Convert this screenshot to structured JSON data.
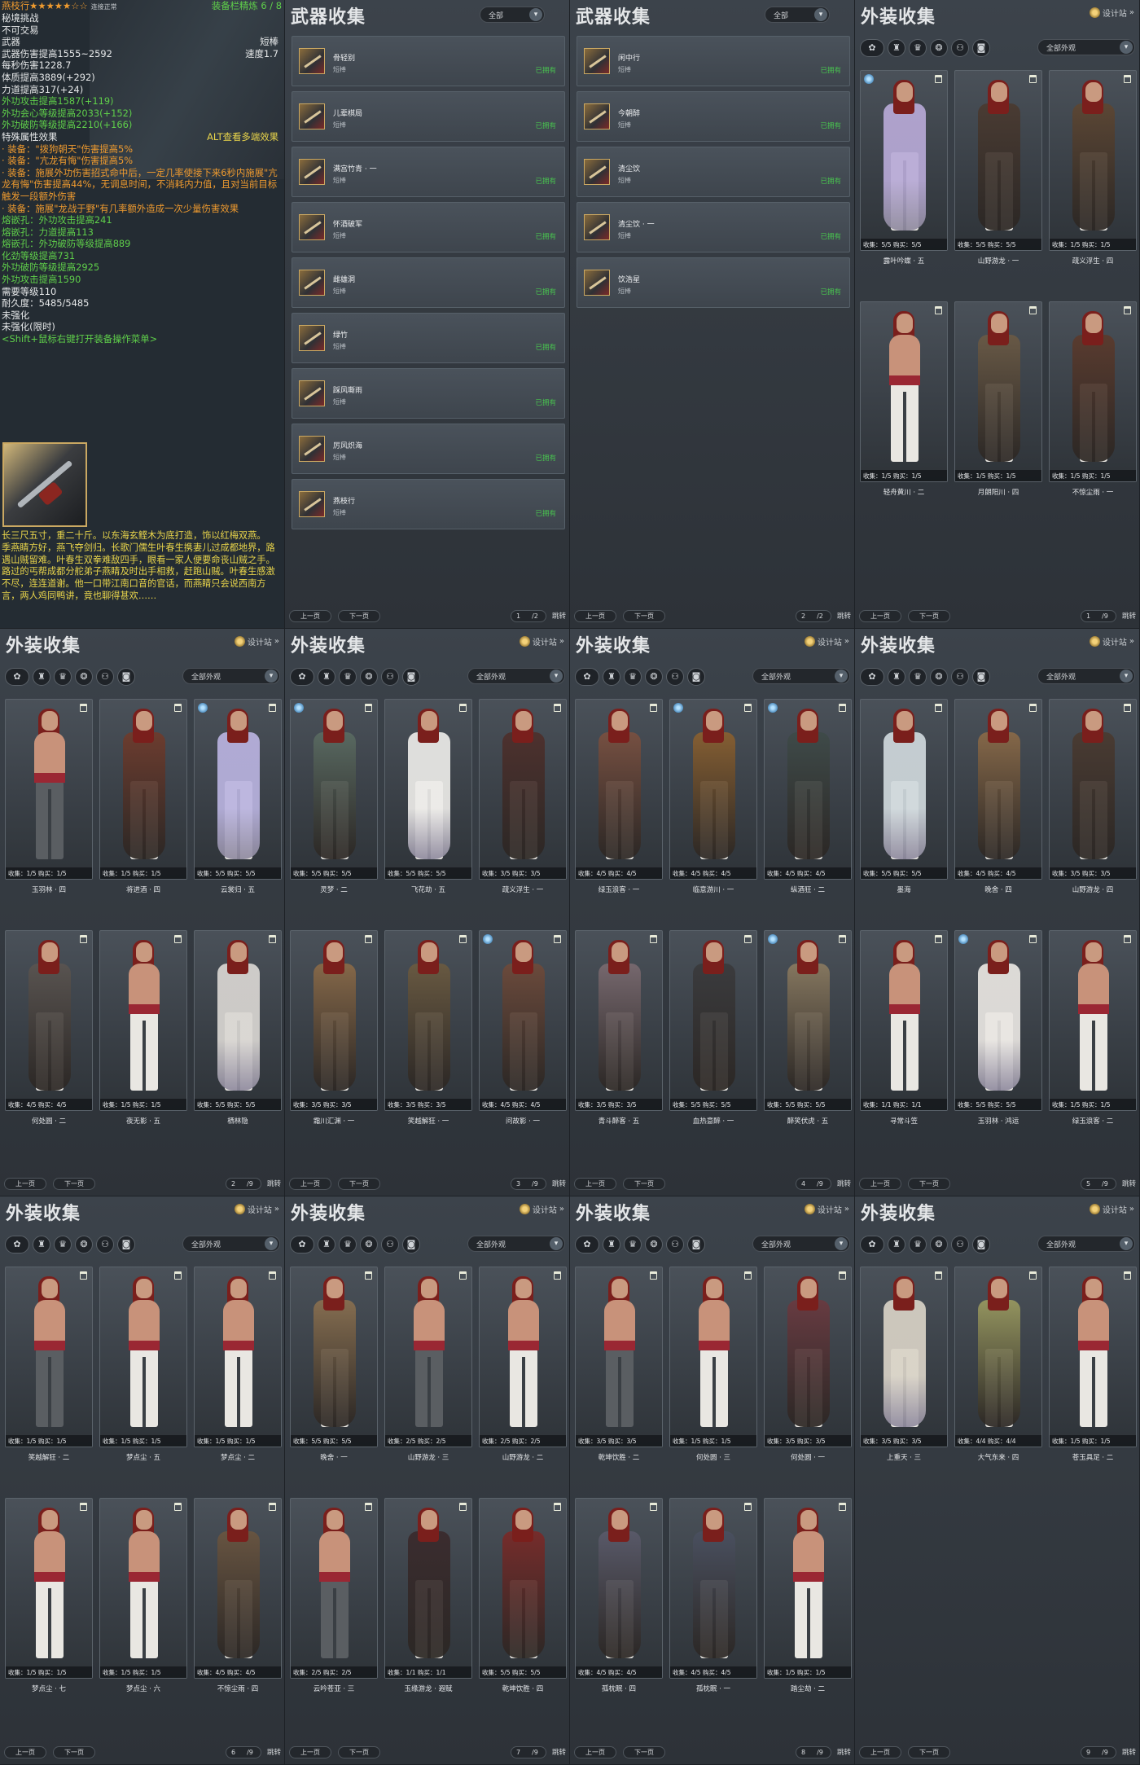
{
  "colors": {
    "accent_gold": "#caa862",
    "green": "#48c44f",
    "orange": "#ee9a2f",
    "yellow": "#e9d54b",
    "bg": "#2e3339"
  },
  "tooltip": {
    "header_name": "燕枝行★★★★★☆☆",
    "header_state": "连接正常",
    "refine": "装备栏精炼 6 / 8",
    "lines": [
      {
        "t": "秘境挑战",
        "c": "c-white"
      },
      {
        "t": "不可交易",
        "c": "c-white"
      },
      {
        "t": "武器",
        "c": "c-white",
        "r": "短棒"
      },
      {
        "t": "武器伤害提高1555~2592",
        "c": "c-white",
        "r": "速度1.7"
      },
      {
        "t": "每秒伤害1228.7",
        "c": "c-white"
      },
      {
        "t": "体质提高3889(+292)",
        "c": "c-white"
      },
      {
        "t": "力道提高317(+24)",
        "c": "c-white"
      },
      {
        "t": "外功攻击提高1587(+119)",
        "c": "c-green"
      },
      {
        "t": "外功会心等级提高2033(+152)",
        "c": "c-green"
      },
      {
        "t": "外功破防等级提高2210(+166)",
        "c": "c-green"
      },
      {
        "t": "特殊属性效果",
        "c": "c-white",
        "r": "ALT查看多端效果",
        "rc": "c-yellow"
      },
      {
        "t": "· 装备：\"拨狗朝天\"伤害提高5%",
        "c": "c-orange"
      },
      {
        "t": "· 装备：\"亢龙有悔\"伤害提高5%",
        "c": "c-orange"
      },
      {
        "t": "· 装备：施展外功伤害招式命中后，一定几率使接下来6秒内施展\"亢龙有悔\"伤害提高44%，无调息时间，不消耗内力值，且对当前目标触发一段额外伤害",
        "c": "c-orange",
        "w": true
      },
      {
        "t": "· 装备：施展\"龙战于野\"有几率额外造成一次少量伤害效果",
        "c": "c-orange",
        "w": true
      },
      {
        "t": "熔嵌孔：外功攻击提高241",
        "c": "c-green"
      },
      {
        "t": "熔嵌孔：力道提高113",
        "c": "c-green"
      },
      {
        "t": "熔嵌孔：外功破防等级提高889",
        "c": "c-green"
      },
      {
        "t": "化劲等级提高731",
        "c": "c-green"
      },
      {
        "t": "外功破防等级提高2925",
        "c": "c-green"
      },
      {
        "t": "外功攻击提高1590",
        "c": "c-green"
      },
      {
        "t": "需要等级110",
        "c": "c-white"
      },
      {
        "t": "耐久度：5485/5485",
        "c": "c-white"
      },
      {
        "t": "未强化",
        "c": "c-white"
      },
      {
        "t": "未强化(限时)",
        "c": "c-white"
      },
      {
        "t": "<Shift+鼠标右键打开装备操作菜单>",
        "c": "c-green"
      }
    ],
    "lore1": "长三尺五寸，重二十斤。以东海玄鲣木为底打造，饰以红梅双燕。",
    "lore2": "季燕睛方好，燕飞夺剑归。长歌门儒生叶春生携妻儿过成都地界，路遇山贼留难。叶春生双拳难敌四手，眼看一家人便要命丧山贼之手。路过的丐帮成都分舵弟子燕睛及时出手相救，赶跑山贼。叶春生感激不尽，连连道谢。他一口带江南口音的官话，而燕睛只会说西南方言，两人鸡同鸭讲，竟也聊得甚欢……"
  },
  "weapons": [
    {
      "title": "武器收集",
      "filter": "全部",
      "items": [
        {
          "name": "骨轻别",
          "type": "短棒",
          "status": "已拥有"
        },
        {
          "name": "儿辈棋局",
          "type": "短棒",
          "status": "已拥有"
        },
        {
          "name": "满宫竹青 · 一",
          "type": "短棒",
          "status": "已拥有"
        },
        {
          "name": "怀酒破军",
          "type": "短棒",
          "status": "已拥有"
        },
        {
          "name": "雌雄洞",
          "type": "短棒",
          "status": "已拥有"
        },
        {
          "name": "绿竹",
          "type": "短棒",
          "status": "已拥有"
        },
        {
          "name": "踩风嘶雨",
          "type": "短棒",
          "status": "已拥有"
        },
        {
          "name": "厉风炽海",
          "type": "短棒",
          "status": "已拥有"
        },
        {
          "name": "燕枝行",
          "type": "短棒",
          "status": "已拥有"
        }
      ],
      "prev": "上一页",
      "next": "下一页",
      "page": "1",
      "total": "/2",
      "jump": "跳转"
    },
    {
      "title": "武器收集",
      "filter": "全部",
      "items": [
        {
          "name": "闲中行",
          "type": "短棒",
          "status": "已拥有"
        },
        {
          "name": "今朝醉",
          "type": "短棒",
          "status": "已拥有"
        },
        {
          "name": "清尘饮",
          "type": "短棒",
          "status": "已拥有"
        },
        {
          "name": "清尘饮 · 一",
          "type": "短棒",
          "status": "已拥有"
        },
        {
          "name": "饮浩星",
          "type": "短棒",
          "status": "已拥有"
        }
      ],
      "prev": "上一页",
      "next": "下一页",
      "page": "2",
      "total": "/2",
      "jump": "跳转"
    }
  ],
  "outfit_common": {
    "title": "外装收集",
    "design": "设计站",
    "more": "»",
    "filter": "全部外观",
    "prev": "上一页",
    "next": "下一页",
    "jump": "跳转",
    "icons": [
      "outfit-all-icon",
      "clothes-icon",
      "hat-icon",
      "cloak-icon",
      "pendant-icon",
      "bag-icon"
    ],
    "icon_glyphs": [
      "✿",
      "♜",
      "♛",
      "❂",
      "⚇",
      "◙"
    ]
  },
  "outfits": [
    {
      "page": "1",
      "total": "/9",
      "cards": [
        {
          "name": "露叶吟蝶 · 五",
          "stats": "收集：5/5  购买：5/5",
          "s": "robe",
          "col": "#b7a9d6",
          "badge": true
        },
        {
          "name": "山野游龙 · 一",
          "stats": "收集：5/5  购买：5/5",
          "s": "dark",
          "col": "#4a3a30"
        },
        {
          "name": "疏义浮生 · 四",
          "stats": "收集：1/5  购买：1/5",
          "s": "dark",
          "col": "#5d4632"
        },
        {
          "name": "轻舟黄川 · 二",
          "stats": "收集：1/5  购买：1/5",
          "s": "base"
        },
        {
          "name": "月朗阳川 · 四",
          "stats": "收集：1/5  购买：1/5",
          "s": "dark",
          "col": "#6b5a45"
        },
        {
          "name": "不惊尘雨 · 一",
          "stats": "收集：1/5  购买：1/5",
          "s": "dark",
          "col": "#5b3a2c"
        }
      ]
    },
    {
      "page": "2",
      "total": "/9",
      "cards": [
        {
          "name": "玉羽林 · 四",
          "stats": "收集：1/5  购买：1/5",
          "s": "base2"
        },
        {
          "name": "将进酒 · 四",
          "stats": "收集：1/5  购买：1/5",
          "s": "dark",
          "col": "#6f3b2c"
        },
        {
          "name": "云裳归 · 五",
          "stats": "收集：5/5  购买：5/5",
          "s": "robe",
          "col": "#b9b3df",
          "badge": true
        },
        {
          "name": "何处圆 · 二",
          "stats": "收集：4/5  购买：4/5",
          "s": "dark",
          "col": "#5a5450"
        },
        {
          "name": "夜无影 · 五",
          "stats": "收集：1/5  购买：1/5",
          "s": "base"
        },
        {
          "name": "栖林隐",
          "stats": "收集：5/5  购买：5/5",
          "s": "robe",
          "col": "#d9d6d2"
        }
      ]
    },
    {
      "page": "3",
      "total": "/9",
      "cards": [
        {
          "name": "灵梦 · 二",
          "stats": "收集：5/5  购买：5/5",
          "s": "dark",
          "col": "#5a6b62",
          "badge": true
        },
        {
          "name": "飞花劫 · 五",
          "stats": "收集：5/5  购买：5/5",
          "s": "robe",
          "col": "#ecebe8"
        },
        {
          "name": "疏义浮生 · 一",
          "stats": "收集：3/5  购买：3/5",
          "s": "dark",
          "col": "#4e2f2b"
        },
        {
          "name": "霜川汇渊 · 一",
          "stats": "收集：3/5  购买：3/5",
          "s": "dark",
          "col": "#8a6a48"
        },
        {
          "name": "笑越解狂 · 一",
          "stats": "收集：3/5  购买：3/5",
          "s": "dark",
          "col": "#6b5a40"
        },
        {
          "name": "问故影 · 一",
          "stats": "收集：4/5  购买：4/5",
          "s": "dark",
          "col": "#6e4a3a",
          "badge": true
        }
      ]
    },
    {
      "page": "4",
      "total": "/9",
      "cards": [
        {
          "name": "绿玉浪客 · 一",
          "stats": "收集：4/5  购买：4/5",
          "s": "dark",
          "col": "#7a5040"
        },
        {
          "name": "临意游川 · 一",
          "stats": "收集：4/5  购买：4/5",
          "s": "dark",
          "col": "#8a6030",
          "badge": true
        },
        {
          "name": "纵酒狂 · 二",
          "stats": "收集：4/5  购买：4/5",
          "s": "dark",
          "col": "#3e4a48",
          "badge": true
        },
        {
          "name": "青斗醉客 · 五",
          "stats": "收集：3/5  购买：3/5",
          "s": "dark",
          "col": "#7a6a70"
        },
        {
          "name": "血热意醉 · 一",
          "stats": "收集：5/5  购买：5/5",
          "s": "dark",
          "col": "#3a3a3c"
        },
        {
          "name": "醉笑伏虎 · 五",
          "stats": "收集：5/5  购买：5/5",
          "s": "dark",
          "col": "#8a7a60",
          "badge": true
        }
      ]
    },
    {
      "page": "5",
      "total": "/9",
      "cards": [
        {
          "name": "墨海",
          "stats": "收集：5/5  购买：5/5",
          "s": "robe",
          "col": "#cfd8dc"
        },
        {
          "name": "晚舍 · 四",
          "stats": "收集：4/5  购买：4/5",
          "s": "dark",
          "col": "#8a6a48"
        },
        {
          "name": "山野游龙 · 四",
          "stats": "收集：3/5  购买：3/5",
          "s": "dark",
          "col": "#4a3a30"
        },
        {
          "name": "寻常斗笠",
          "stats": "收集：1/1  购买：1/1",
          "s": "base"
        },
        {
          "name": "玉羽林 · 鸿运",
          "stats": "收集：5/5  购买：5/5",
          "s": "robe",
          "col": "#e9e6e2",
          "badge": true
        },
        {
          "name": "绿玉浪客 · 二",
          "stats": "收集：1/5  购买：1/5",
          "s": "base"
        }
      ]
    },
    {
      "page": "6",
      "total": "/9",
      "cards": [
        {
          "name": "笑越解狂 · 二",
          "stats": "收集：1/5  购买：1/5",
          "s": "base2"
        },
        {
          "name": "梦点尘 · 五",
          "stats": "收集：1/5  购买：1/5",
          "s": "base"
        },
        {
          "name": "梦点尘 · 二",
          "stats": "收集：1/5  购买：1/5",
          "s": "base"
        },
        {
          "name": "梦点尘 · 七",
          "stats": "收集：1/5  购买：1/5",
          "s": "base"
        },
        {
          "name": "梦点尘 · 六",
          "stats": "收集：1/5  购买：1/5",
          "s": "base"
        },
        {
          "name": "不惊尘雨 · 四",
          "stats": "收集：4/5  购买：4/5",
          "s": "dark",
          "col": "#6a5540"
        }
      ]
    },
    {
      "page": "7",
      "total": "/9",
      "cards": [
        {
          "name": "晚舍 · 一",
          "stats": "收集：5/5  购买：5/5",
          "s": "dark",
          "col": "#8a7050"
        },
        {
          "name": "山野游龙 · 三",
          "stats": "收集：2/5  购买：2/5",
          "s": "base2"
        },
        {
          "name": "山野游龙 · 二",
          "stats": "收集：2/5  购买：2/5",
          "s": "base"
        },
        {
          "name": "云吟苍亚 · 三",
          "stats": "收集：2/5  购买：2/5",
          "s": "base2"
        },
        {
          "name": "玉缘游龙 · 遐赋",
          "stats": "收集：1/1  购买：1/1",
          "s": "dark",
          "col": "#3a2a2c"
        },
        {
          "name": "乾坤饮胜 · 四",
          "stats": "收集：5/5  购买：5/5",
          "s": "dark",
          "col": "#7a2a28"
        }
      ]
    },
    {
      "page": "8",
      "total": "/9",
      "cards": [
        {
          "name": "乾坤饮胜 · 二",
          "stats": "收集：3/5  购买：3/5",
          "s": "base2"
        },
        {
          "name": "何处圆 · 三",
          "stats": "收集：1/5  购买：1/5",
          "s": "base"
        },
        {
          "name": "何处圆 · 一",
          "stats": "收集：3/5  购买：3/5",
          "s": "dark",
          "col": "#6a3a40"
        },
        {
          "name": "孤枕眠 · 四",
          "stats": "收集：4/5  购买：4/5",
          "s": "dark",
          "col": "#5a5a6a"
        },
        {
          "name": "孤枕眠 · 一",
          "stats": "收集：4/5  购买：4/5",
          "s": "dark",
          "col": "#4a5060"
        },
        {
          "name": "踏尘劫 · 二",
          "stats": "收集：1/5  购买：1/5",
          "s": "base"
        }
      ]
    },
    {
      "page": "9",
      "total": "/9",
      "cards": [
        {
          "name": "上重天 · 三",
          "stats": "收集：3/5  购买：3/5",
          "s": "robe",
          "col": "#d8d2c6"
        },
        {
          "name": "大气东来 · 四",
          "stats": "收集：4/4  购买：4/4",
          "s": "dark",
          "col": "#9a9a60"
        },
        {
          "name": "苍玉具足 · 二",
          "stats": "收集：1/5  购买：1/5",
          "s": "base"
        }
      ]
    }
  ]
}
